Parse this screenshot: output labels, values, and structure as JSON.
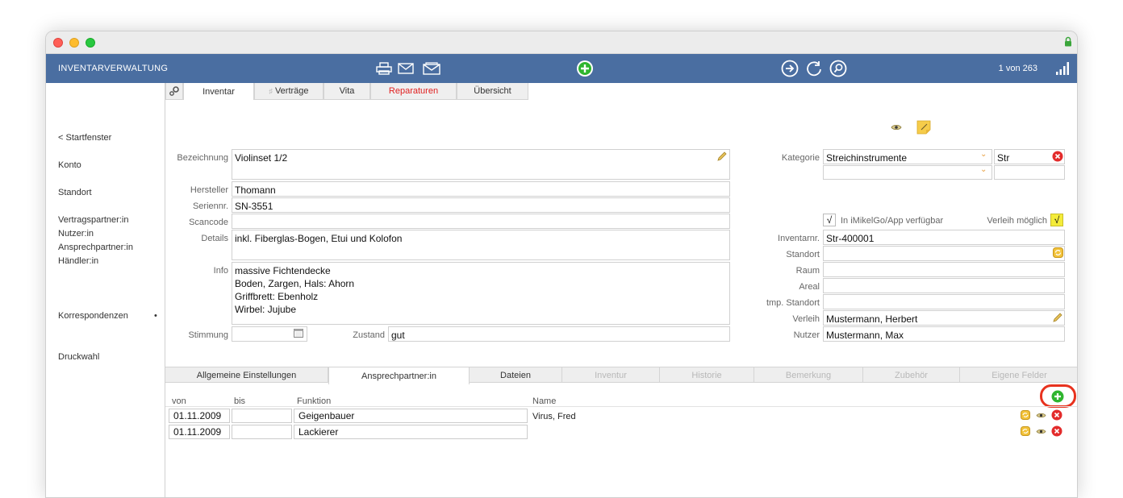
{
  "window": {
    "title": "INVENTARVERWALTUNG",
    "record_count": "1 von 263"
  },
  "toolbar": {
    "icons": [
      "printer-icon",
      "mail-icon",
      "mail-open-icon",
      "add-record-icon",
      "arrow-right-icon",
      "refresh-icon",
      "search-icon",
      "signal-bars-icon"
    ]
  },
  "sidebar": {
    "back": "< Startfenster",
    "konto": "Konto",
    "standort": "Standort",
    "vertragspartner": "Vertragspartner:in",
    "nutzer": "Nutzer:in",
    "ansprechpartner": "Ansprechpartner:in",
    "haendler": "Händler:in",
    "korrespondenzen": "Korrespondenzen",
    "korrespondenzen_dot": "•",
    "druckwahl": "Druckwahl"
  },
  "tabs": {
    "inventar": "Inventar",
    "vertraege": "Verträge",
    "vita": "Vita",
    "reparaturen": "Reparaturen",
    "uebersicht": "Übersicht"
  },
  "colors": {
    "toolbar": "#4a6ea1",
    "reparaturen": "#e02020",
    "highlight_circle": "#e8321e",
    "add_green": "#2fb52f"
  },
  "form": {
    "bezeichnung_label": "Bezeichnung",
    "bezeichnung": "Violinset 1/2",
    "hersteller_label": "Hersteller",
    "hersteller": "Thomann",
    "seriennr_label": "Seriennr.",
    "seriennr": "SN-3551",
    "scancode_label": "Scancode",
    "scancode": "",
    "details_label": "Details",
    "details": "inkl. Fiberglas-Bogen, Etui und Kolofon",
    "info_label": "Info",
    "info": "massive Fichtendecke\nBoden, Zargen, Hals: Ahorn\nGriffbrett: Ebenholz\nWirbel: Jujube",
    "stimmung_label": "Stimmung",
    "stimmung": "",
    "zustand_label": "Zustand",
    "zustand": "gut",
    "kategorie_label": "Kategorie",
    "kategorie": "Streichinstrumente",
    "kategorie_code": "Str",
    "unterkategorie": "",
    "unterkategorie_code": "",
    "app_check": "√",
    "app_label": "In iMikelGo/App verfügbar",
    "verleih_label_check": "Verleih möglich",
    "verleih_check": "√",
    "inventarnr_label": "Inventarnr.",
    "inventarnr": "Str-400001",
    "standort_label": "Standort",
    "standort": "",
    "raum_label": "Raum",
    "raum": "",
    "areal_label": "Areal",
    "areal": "",
    "tmp_standort_label": "tmp. Standort",
    "tmp_standort": "",
    "verleih_label": "Verleih",
    "verleih": "Mustermann, Herbert",
    "nutzer_label": "Nutzer",
    "nutzer": "Mustermann, Max"
  },
  "subtabs": {
    "allgemein": "Allgemeine Einstellungen",
    "ansprechpartner": "Ansprechpartner:in",
    "dateien": "Dateien",
    "inventur": "Inventur",
    "historie": "Historie",
    "bemerkung": "Bemerkung",
    "zubehoer": "Zubehör",
    "eigene_felder": "Eigene Felder"
  },
  "contacts": {
    "headers": {
      "von": "von",
      "bis": "bis",
      "funktion": "Funktion",
      "name": "Name"
    },
    "rows": [
      {
        "von": "01.11.2009",
        "bis": "",
        "funktion": "Geigenbauer",
        "name": "Virus, Fred"
      },
      {
        "von": "01.11.2009",
        "bis": "",
        "funktion": "Lackierer",
        "name": ""
      }
    ]
  }
}
